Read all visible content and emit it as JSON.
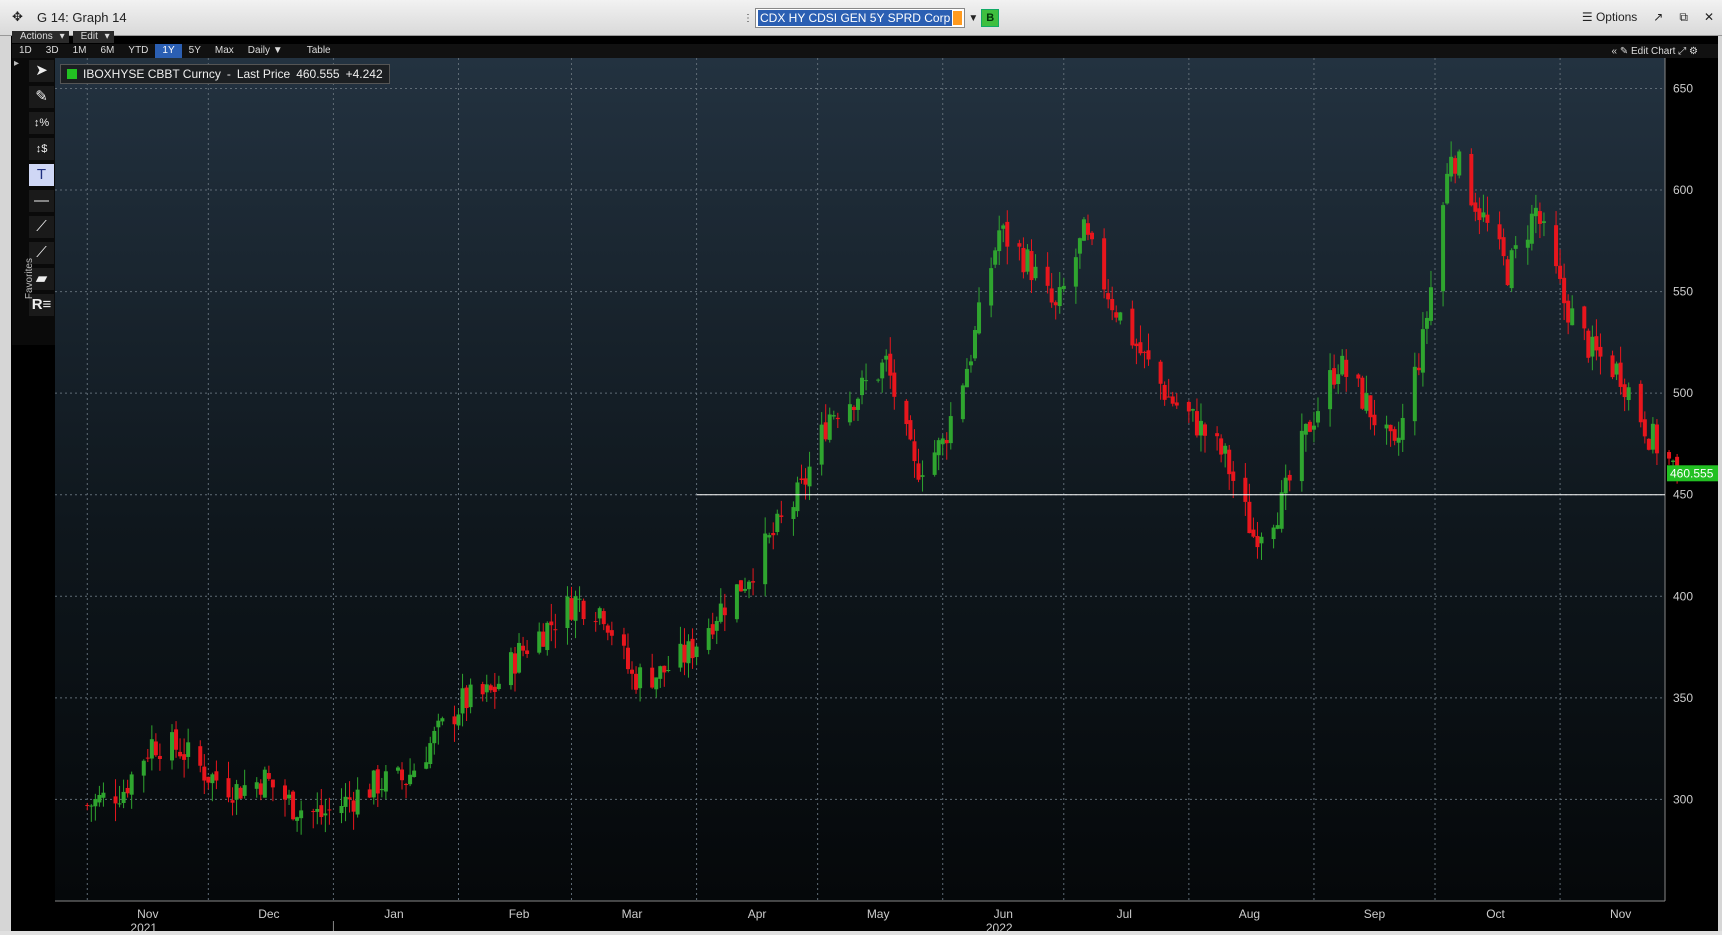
{
  "window": {
    "title": "G 14: Graph 14",
    "security": "CDX HY CDSI GEN 5Y SPRD Corp",
    "b_button": "B",
    "options": "Options"
  },
  "menu": {
    "actions": "Actions",
    "edit": "Edit"
  },
  "toolbar": {
    "periods": [
      "1D",
      "3D",
      "1M",
      "6M",
      "YTD",
      "1Y",
      "5Y",
      "Max"
    ],
    "active_period": "1Y",
    "frequency": "Daily",
    "table": "Table",
    "edit_chart": "Edit Chart"
  },
  "favorites_label": "Favorites",
  "legend": {
    "security": "IBOXHYSE CBBT Curncy",
    "field": "Last Price",
    "value": "460.555",
    "change": "+4.242"
  },
  "colors": {
    "up": "#2fa52f",
    "down": "#e8161d",
    "last_price_tag": "#22c022",
    "hline": "#ffffff"
  },
  "chart_data": {
    "type": "candlestick",
    "ylim": [
      250,
      665
    ],
    "yticks": [
      300,
      350,
      400,
      450,
      500,
      550,
      600,
      650
    ],
    "xticks": [
      "Nov",
      "Dec",
      "Jan",
      "Feb",
      "Mar",
      "Apr",
      "May",
      "Jun",
      "Jul",
      "Aug",
      "Sep",
      "Oct",
      "Nov"
    ],
    "year_labels": [
      "2021",
      "2022"
    ],
    "last_price": 460.555,
    "horizontal_line": 450,
    "close_path": [
      {
        "date": "2021-11-01",
        "close": 297
      },
      {
        "date": "2021-11-10",
        "close": 305
      },
      {
        "date": "2021-11-17",
        "close": 328
      },
      {
        "date": "2021-11-24",
        "close": 325
      },
      {
        "date": "2021-12-01",
        "close": 312
      },
      {
        "date": "2021-12-08",
        "close": 305
      },
      {
        "date": "2021-12-15",
        "close": 310
      },
      {
        "date": "2021-12-22",
        "close": 297
      },
      {
        "date": "2021-12-29",
        "close": 292
      },
      {
        "date": "2022-01-05",
        "close": 300
      },
      {
        "date": "2022-01-12",
        "close": 308
      },
      {
        "date": "2022-01-19",
        "close": 310
      },
      {
        "date": "2022-01-26",
        "close": 330
      },
      {
        "date": "2022-02-02",
        "close": 348
      },
      {
        "date": "2022-02-09",
        "close": 352
      },
      {
        "date": "2022-02-16",
        "close": 372
      },
      {
        "date": "2022-02-23",
        "close": 385
      },
      {
        "date": "2022-03-02",
        "close": 398
      },
      {
        "date": "2022-03-09",
        "close": 393
      },
      {
        "date": "2022-03-16",
        "close": 360
      },
      {
        "date": "2022-03-23",
        "close": 362
      },
      {
        "date": "2022-03-30",
        "close": 372
      },
      {
        "date": "2022-04-06",
        "close": 392
      },
      {
        "date": "2022-04-13",
        "close": 408
      },
      {
        "date": "2022-04-20",
        "close": 430
      },
      {
        "date": "2022-04-27",
        "close": 452
      },
      {
        "date": "2022-05-04",
        "close": 490
      },
      {
        "date": "2022-05-11",
        "close": 500
      },
      {
        "date": "2022-05-18",
        "close": 515
      },
      {
        "date": "2022-05-25",
        "close": 462
      },
      {
        "date": "2022-06-01",
        "close": 475
      },
      {
        "date": "2022-06-08",
        "close": 520
      },
      {
        "date": "2022-06-15",
        "close": 580
      },
      {
        "date": "2022-06-22",
        "close": 565
      },
      {
        "date": "2022-06-29",
        "close": 540
      },
      {
        "date": "2022-07-06",
        "close": 578
      },
      {
        "date": "2022-07-13",
        "close": 545
      },
      {
        "date": "2022-07-20",
        "close": 520
      },
      {
        "date": "2022-07-27",
        "close": 498
      },
      {
        "date": "2022-08-03",
        "close": 485
      },
      {
        "date": "2022-08-10",
        "close": 468
      },
      {
        "date": "2022-08-17",
        "close": 430
      },
      {
        "date": "2022-08-24",
        "close": 445
      },
      {
        "date": "2022-08-31",
        "close": 485
      },
      {
        "date": "2022-09-07",
        "close": 515
      },
      {
        "date": "2022-09-14",
        "close": 495
      },
      {
        "date": "2022-09-21",
        "close": 470
      },
      {
        "date": "2022-09-28",
        "close": 525
      },
      {
        "date": "2022-10-05",
        "close": 620
      },
      {
        "date": "2022-10-12",
        "close": 590
      },
      {
        "date": "2022-10-19",
        "close": 560
      },
      {
        "date": "2022-10-26",
        "close": 590
      },
      {
        "date": "2022-11-02",
        "close": 545
      },
      {
        "date": "2022-11-09",
        "close": 520
      },
      {
        "date": "2022-11-16",
        "close": 510
      },
      {
        "date": "2022-11-23",
        "close": 480
      },
      {
        "date": "2022-11-30",
        "close": 460.555
      }
    ]
  }
}
